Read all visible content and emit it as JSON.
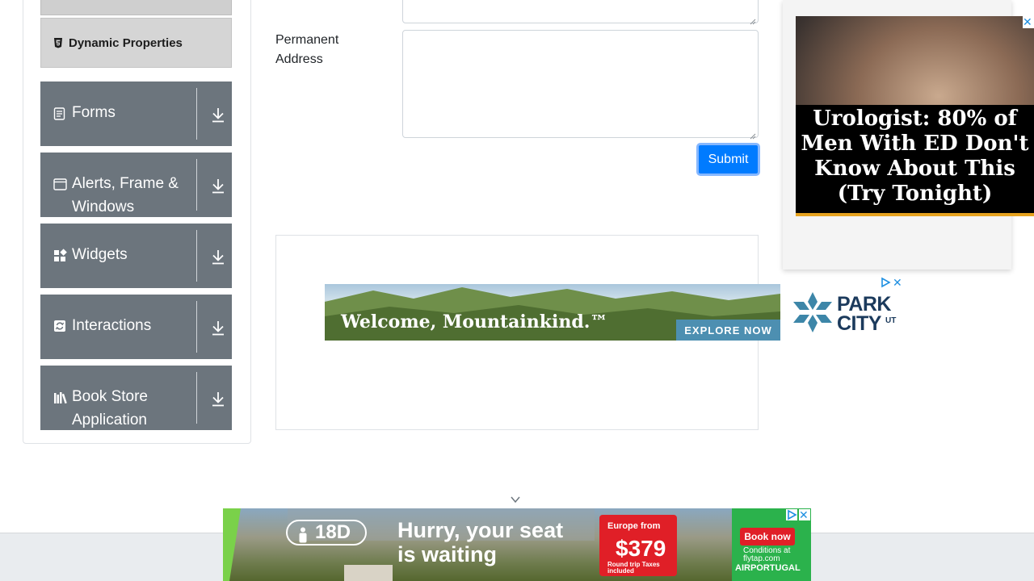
{
  "nav": {
    "active_item": "Dynamic Properties",
    "groups": [
      {
        "label": "Forms",
        "icon": "form-icon"
      },
      {
        "label": "Alerts, Frame & Windows",
        "icon": "window-icon"
      },
      {
        "label": "Widgets",
        "icon": "widgets-icon"
      },
      {
        "label": "Interactions",
        "icon": "interactions-icon"
      },
      {
        "label": "Book Store Application",
        "icon": "books-icon"
      }
    ]
  },
  "form": {
    "permanent_address_label": "Permanent Address",
    "permanent_address_value": "",
    "submit_label": "Submit"
  },
  "ads": {
    "park_city": {
      "headline": "Welcome, Mountainkind.™",
      "cta": "EXPLORE NOW",
      "brand": "PARK CITY",
      "brand_suffix": "UT"
    },
    "right": {
      "headline": "Urologist: 80% of Men With ED Don't Know About This (Try Tonight)"
    },
    "bottom": {
      "seat_class": "18D",
      "headline": "Hurry, your seat is waiting",
      "price_region": "Europe from",
      "price": "$379",
      "price_note": "Round trip Taxes included",
      "cta": "Book now",
      "conditions": "Conditions at flytap.com",
      "airline": "AIRPORTUGAL"
    }
  },
  "colors": {
    "nav_group_bg": "#6c757d",
    "active_item_bg": "#d5d5d5",
    "submit_bg": "#007bff",
    "ad_close": "#1e8fe1"
  }
}
